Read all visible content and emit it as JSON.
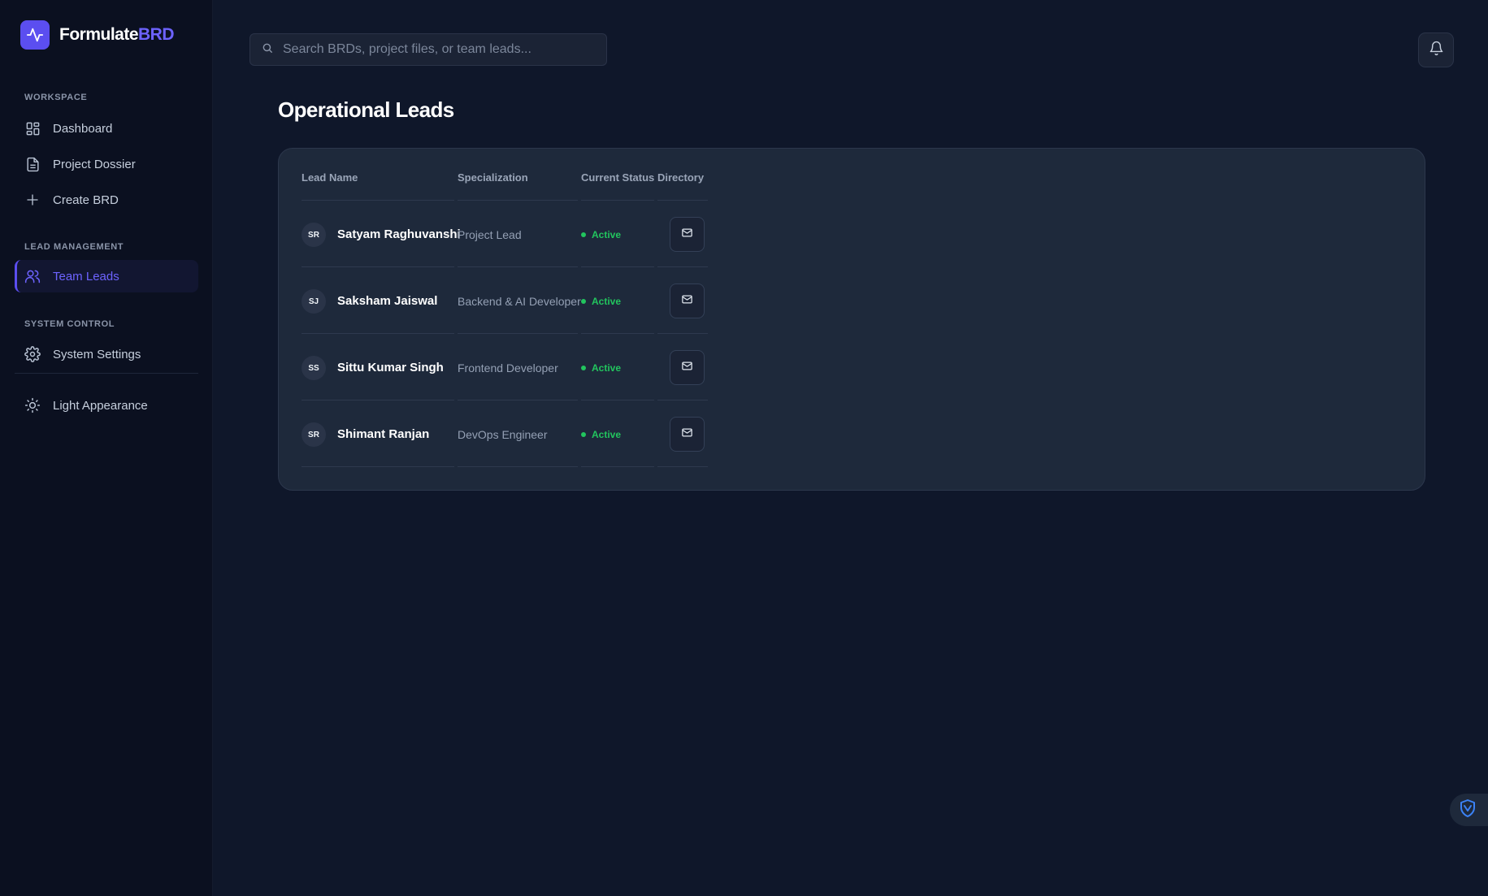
{
  "brand": {
    "name_primary": "Formulate",
    "name_accent": "BRD"
  },
  "sidebar": {
    "sections": [
      {
        "label": "WORKSPACE"
      },
      {
        "label": "LEAD MANAGEMENT"
      },
      {
        "label": "SYSTEM CONTROL"
      }
    ],
    "items": [
      {
        "label": "Dashboard",
        "icon": "dashboard-icon"
      },
      {
        "label": "Project Dossier",
        "icon": "document-icon"
      },
      {
        "label": "Create BRD",
        "icon": "plus-icon"
      },
      {
        "label": "Team Leads",
        "icon": "users-icon",
        "active": true
      },
      {
        "label": "System Settings",
        "icon": "gear-icon"
      },
      {
        "label": "Light Appearance",
        "icon": "sun-icon"
      }
    ]
  },
  "search": {
    "placeholder": "Search BRDs, project files, or team leads...",
    "value": ""
  },
  "page": {
    "title": "Operational Leads"
  },
  "table": {
    "headers": [
      "Lead Name",
      "Specialization",
      "Current Status",
      "Directory"
    ],
    "rows": [
      {
        "initials": "SR",
        "name": "Satyam Raghuvanshi",
        "specialization": "Project Lead",
        "status": "Active"
      },
      {
        "initials": "SJ",
        "name": "Saksham Jaiswal",
        "specialization": "Backend & AI Developer",
        "status": "Active"
      },
      {
        "initials": "SS",
        "name": "Sittu Kumar Singh",
        "specialization": "Frontend Developer",
        "status": "Active"
      },
      {
        "initials": "SR",
        "name": "Shimant Ranjan",
        "specialization": "DevOps Engineer",
        "status": "Active"
      }
    ]
  },
  "colors": {
    "accent": "#5b4ef0",
    "status_active": "#22c55e",
    "background": "#0f172a",
    "card": "#1e293b"
  }
}
